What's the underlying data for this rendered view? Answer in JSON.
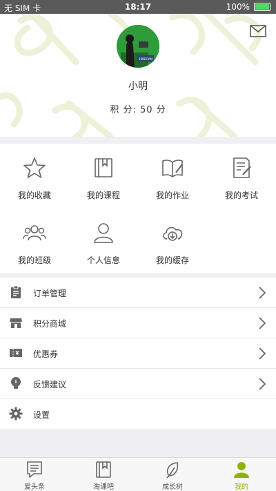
{
  "status_bar": {
    "carrier": "无 SIM 卡",
    "time": "18:17",
    "battery": "100%",
    "battery_level": 1.0
  },
  "header": {
    "nickname": "小明",
    "points_text": "积  分:  50 分",
    "avatar_caption": "1988 RAM",
    "icons": {
      "mail": "mail-icon",
      "avatar": "avatar"
    }
  },
  "shortcuts": [
    {
      "label": "我的收藏",
      "icon": "star-icon"
    },
    {
      "label": "我的课程",
      "icon": "book-icon"
    },
    {
      "label": "我的作业",
      "icon": "open-book-pen-icon"
    },
    {
      "label": "我的考试",
      "icon": "exam-paper-icon"
    },
    {
      "label": "我的班级",
      "icon": "group-icon"
    },
    {
      "label": "个人信息",
      "icon": "person-icon"
    },
    {
      "label": "我的缓存",
      "icon": "cloud-download-icon"
    }
  ],
  "menu": [
    {
      "label": "订单管理",
      "icon": "clipboard-icon"
    },
    {
      "label": "积分商城",
      "icon": "store-icon"
    },
    {
      "label": "优惠券",
      "icon": "coupon-icon"
    },
    {
      "label": "反馈建议",
      "icon": "lightbulb-icon"
    },
    {
      "label": "设置",
      "icon": "gear-icon"
    }
  ],
  "tabbar": [
    {
      "label": "爱头条",
      "icon": "news-icon",
      "active": false
    },
    {
      "label": "淘课吧",
      "icon": "course-book-icon",
      "active": false
    },
    {
      "label": "成长树",
      "icon": "leaf-icon",
      "active": false
    },
    {
      "label": "我的",
      "icon": "profile-icon",
      "active": true
    }
  ],
  "colors": {
    "accent": "#8fb300",
    "icon_gray": "#666666",
    "pattern": "#eef0d8"
  }
}
